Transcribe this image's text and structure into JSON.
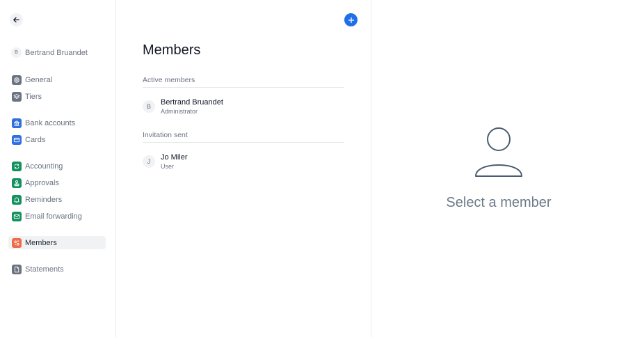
{
  "sidebar": {
    "user": {
      "initial": "B",
      "name": "Bertrand Bruandet"
    },
    "items": [
      {
        "label": "General",
        "icon": "gear-icon",
        "color": "#6b7280"
      },
      {
        "label": "Tiers",
        "icon": "layers-icon",
        "color": "#6b7280"
      },
      {
        "label": "Bank accounts",
        "icon": "bank-icon",
        "color": "#2f6fde"
      },
      {
        "label": "Cards",
        "icon": "card-icon",
        "color": "#2f6fde"
      },
      {
        "label": "Accounting",
        "icon": "sync-icon",
        "color": "#15915f"
      },
      {
        "label": "Approvals",
        "icon": "stamp-icon",
        "color": "#15915f"
      },
      {
        "label": "Reminders",
        "icon": "bell-icon",
        "color": "#15915f"
      },
      {
        "label": "Email forwarding",
        "icon": "mail-icon",
        "color": "#15915f"
      },
      {
        "label": "Members",
        "icon": "people-icon",
        "color": "#ef6c4a",
        "active": true
      },
      {
        "label": "Statements",
        "icon": "document-icon",
        "color": "#6b7280"
      }
    ]
  },
  "members": {
    "title": "Members",
    "active_header": "Active members",
    "active": [
      {
        "initial": "B",
        "name": "Bertrand Bruandet",
        "role": "Administrator"
      }
    ],
    "invited_header": "Invitation sent",
    "invited": [
      {
        "initial": "J",
        "name": "Jo Miler",
        "role": "User"
      }
    ]
  },
  "detail": {
    "placeholder": "Select a member"
  },
  "colors": {
    "accent": "#1e6fe8"
  }
}
